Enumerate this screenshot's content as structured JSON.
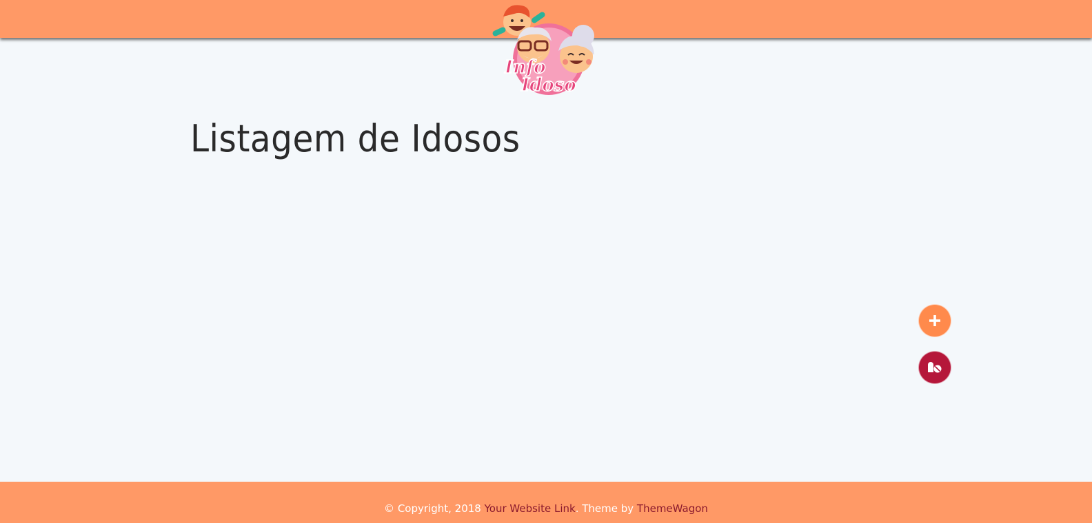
{
  "header": {
    "logo_text_line1": "Info",
    "logo_text_line2": "Idoso",
    "icon": "logo-icon"
  },
  "main": {
    "title": "Listagem de Idosos"
  },
  "actions": {
    "add_button_glyph": "+",
    "add_button_icon": "plus-icon",
    "med_button_icon": "pills-icon"
  },
  "footer": {
    "copyright": "© Copyright, 2018",
    "website_link": "Your Website Link",
    "theme_by": ". Theme by",
    "themewagon_link": "ThemeWagon"
  },
  "colors": {
    "bar": "#ff9966",
    "add_button": "#ff8a4c",
    "med_button": "#b5173a",
    "link": "#8b1a2e",
    "background": "#f4f8fb"
  }
}
